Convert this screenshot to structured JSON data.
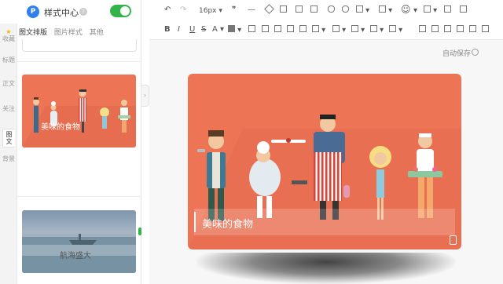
{
  "panel": {
    "logo": "P",
    "title": "样式中心",
    "help": "?",
    "toggle_on": true
  },
  "vtabs": [
    {
      "label": "收藏",
      "star": "★"
    },
    {
      "label": "标题"
    },
    {
      "label": "正文"
    },
    {
      "label": "关注"
    },
    {
      "label": "图文"
    },
    {
      "label": "背景"
    }
  ],
  "subtabs": [
    "图文排版",
    "图片样式",
    "其他"
  ],
  "cards": [
    {
      "caption": "美味的食物",
      "colors": {
        "bg": "#ee7456"
      }
    },
    {
      "caption": "航海盛大",
      "colors": {
        "bg": "#8da2b5"
      }
    }
  ],
  "toolbar": {
    "undo": "↶",
    "redo": "↷",
    "font_size": "16px",
    "quote": "❞",
    "hr": "—",
    "clear": "⌫",
    "bold": "B",
    "italic": "I",
    "underline": "U",
    "strike": "S",
    "font_color": "A",
    "emoji": "☺"
  },
  "editor": {
    "autosave": "自动保存",
    "poster_caption": "美味的食物",
    "colors": {
      "poster_bg": "#ee7456",
      "accent": "#32b44a",
      "brand": "#2f80ed"
    }
  }
}
